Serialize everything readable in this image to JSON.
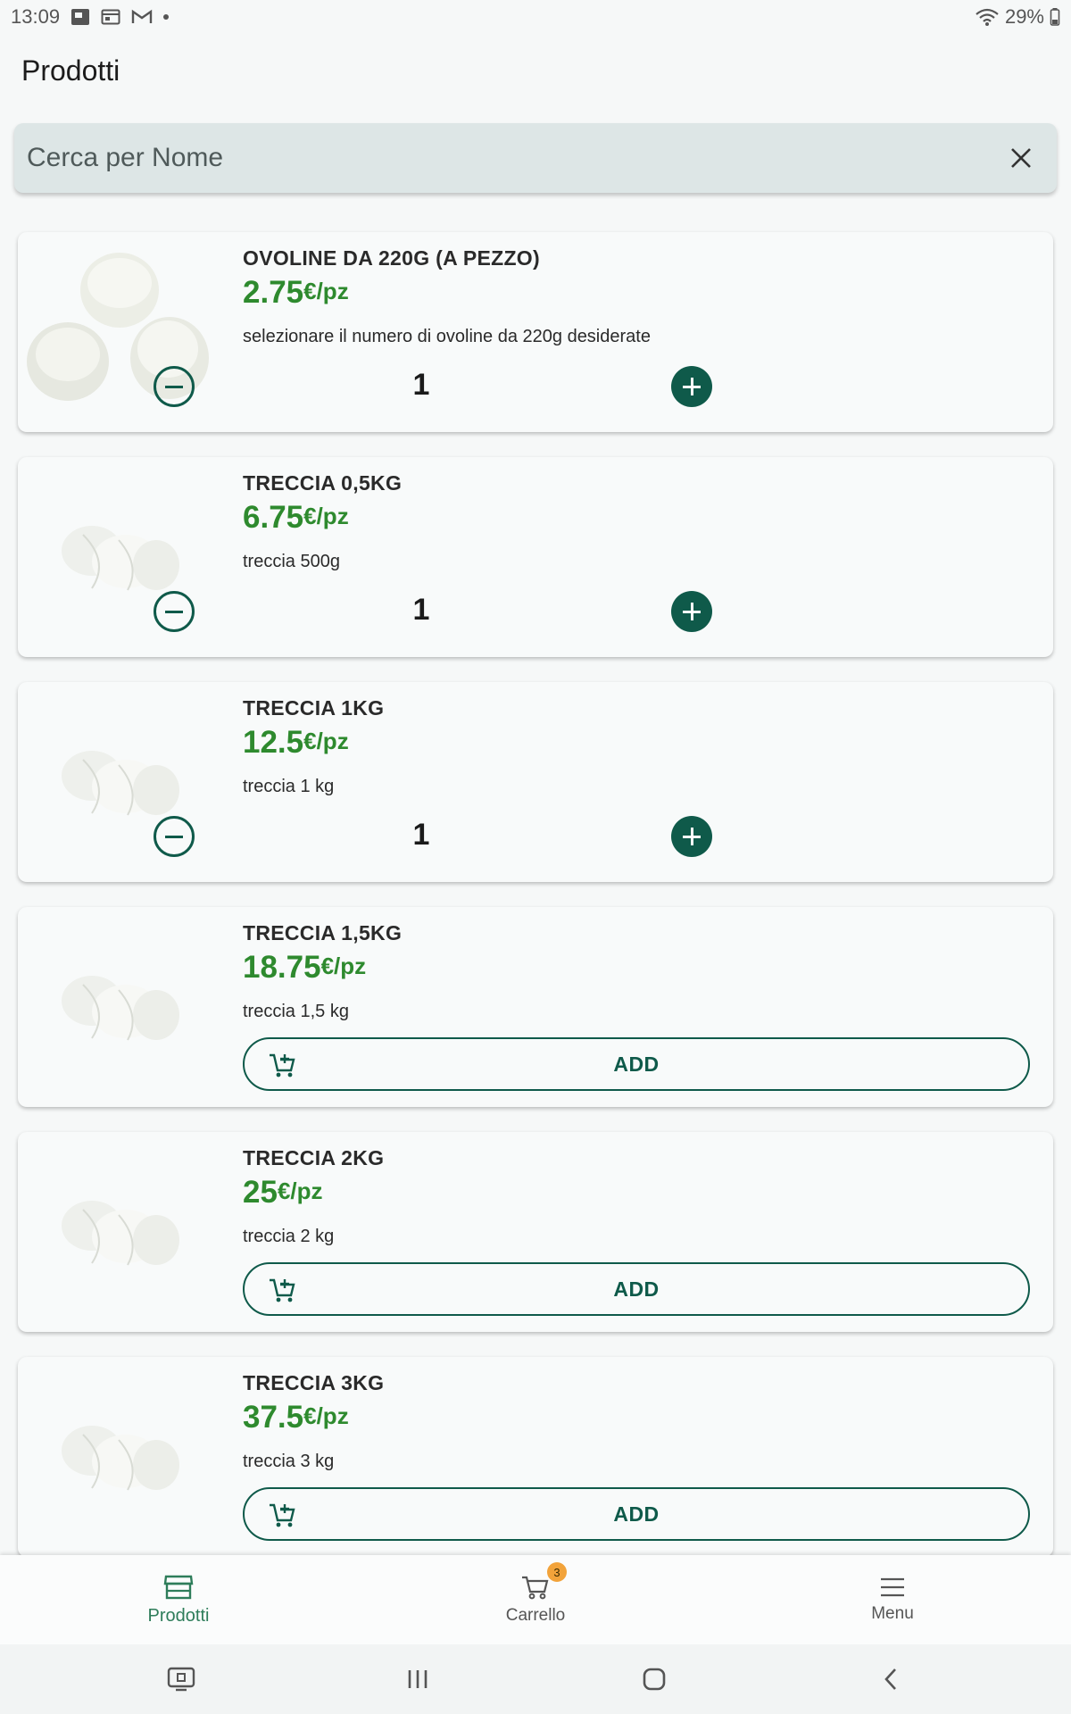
{
  "status_bar": {
    "time": "13:09",
    "battery": "29%",
    "icons": [
      "screenshot-icon",
      "calendar-icon",
      "gmail-icon",
      "notification-dot-icon",
      "wifi-icon",
      "battery-icon"
    ]
  },
  "app_bar": {
    "title": "Prodotti"
  },
  "search": {
    "placeholder": "Cerca per Nome",
    "value": "",
    "clear_icon": "close-icon"
  },
  "colors": {
    "accent": "#0f5a4a",
    "price": "#2e8a2e",
    "badge": "#f2a33a"
  },
  "products": [
    {
      "name": "OVOLINE DA 220G (A PEZZO)",
      "price": "2.75",
      "unit": "€/pz",
      "description": "selezionare il numero di ovoline da 220g desiderate",
      "quantity": "1",
      "image": "ovoline"
    },
    {
      "name": "TRECCIA 0,5KG",
      "price": "6.75",
      "unit": "€/pz",
      "description": "treccia 500g",
      "quantity": "1",
      "image": "treccia"
    },
    {
      "name": "TRECCIA 1KG",
      "price": "12.5",
      "unit": "€/pz",
      "description": "treccia 1 kg",
      "quantity": "1",
      "image": "treccia"
    },
    {
      "name": "TRECCIA 1,5KG",
      "price": "18.75",
      "unit": "€/pz",
      "description": "treccia 1,5 kg",
      "add_label": "ADD",
      "image": "treccia"
    },
    {
      "name": "TRECCIA 2KG",
      "price": "25",
      "unit": "€/pz",
      "description": "treccia 2 kg",
      "add_label": "ADD",
      "image": "treccia"
    },
    {
      "name": "TRECCIA 3KG",
      "price": "37.5",
      "unit": "€/pz",
      "description": "treccia 3 kg",
      "add_label": "ADD",
      "image": "treccia"
    }
  ],
  "bottom_nav": {
    "items": [
      {
        "label": "Prodotti",
        "icon": "store-icon",
        "active": true
      },
      {
        "label": "Carrello",
        "icon": "cart-icon",
        "badge": "3"
      },
      {
        "label": "Menu",
        "icon": "menu-icon"
      }
    ]
  },
  "system_nav": [
    "secure-folder-icon",
    "recents-icon",
    "home-icon",
    "back-icon"
  ]
}
